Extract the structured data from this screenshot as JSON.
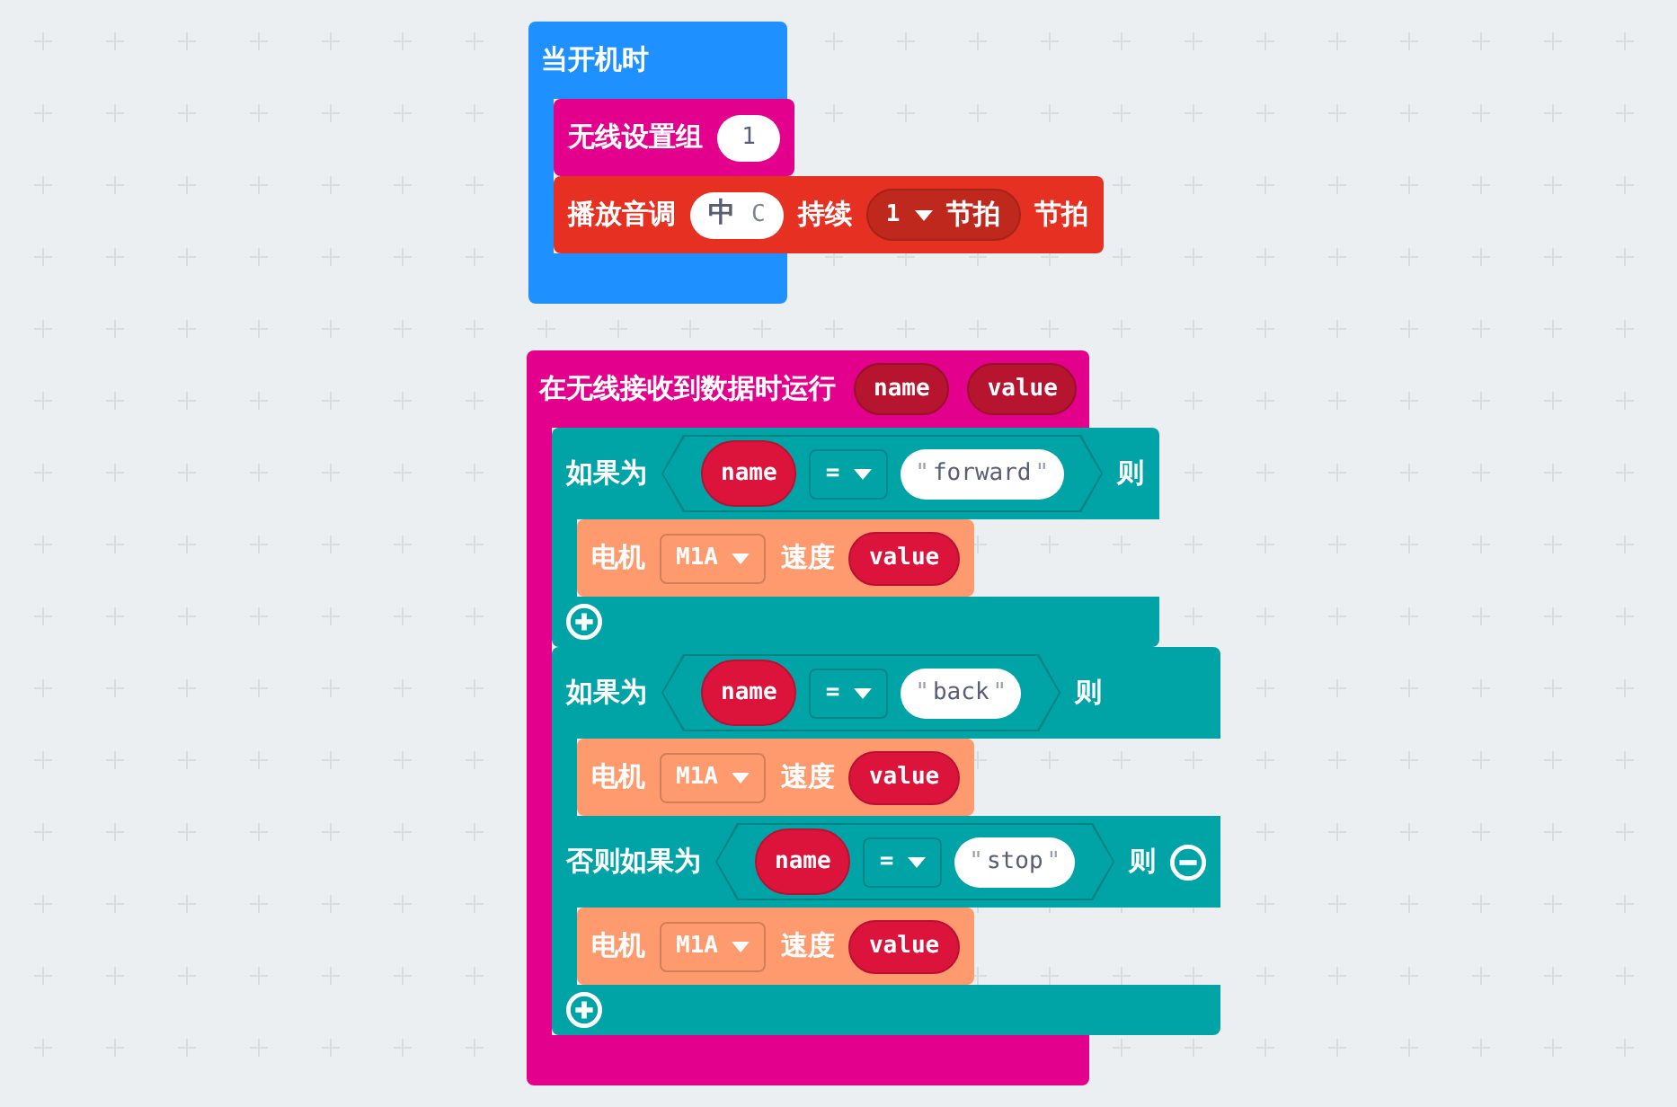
{
  "workspace": {
    "stacks": [
      {
        "kind": "event",
        "color": "#1e90ff",
        "header": [
          {
            "kind": "label",
            "text": "当开机时"
          }
        ],
        "body": [
          {
            "kind": "statement",
            "color": "#e3008c",
            "parts": [
              {
                "kind": "label",
                "text": "无线设置组"
              },
              {
                "kind": "number",
                "text": "1"
              }
            ]
          },
          {
            "kind": "statement",
            "color": "#e63022",
            "parts": [
              {
                "kind": "label",
                "text": "播放音调"
              },
              {
                "kind": "note",
                "octave": "中",
                "pitch": "C"
              },
              {
                "kind": "label",
                "text": "持续"
              },
              {
                "kind": "dropdown_oval",
                "value": "1",
                "unit": "节拍"
              },
              {
                "kind": "label",
                "text": "节拍"
              }
            ]
          }
        ]
      },
      {
        "kind": "event",
        "color": "#e3008c",
        "header": [
          {
            "kind": "label",
            "text": "在无线接收到数据时运行"
          },
          {
            "kind": "param",
            "text": "name"
          },
          {
            "kind": "param",
            "text": "value"
          }
        ],
        "body": [
          {
            "kind": "if",
            "color": "#00a4a6",
            "clauses": [
              {
                "removable": false,
                "header": [
                  {
                    "kind": "label",
                    "text": "如果为"
                  },
                  {
                    "kind": "condition",
                    "parts": [
                      {
                        "kind": "reporter",
                        "text": "name"
                      },
                      {
                        "kind": "dropdown",
                        "text": "="
                      },
                      {
                        "kind": "string",
                        "open_quote": "\"",
                        "text": "forward",
                        "close_quote": "\""
                      }
                    ]
                  },
                  {
                    "kind": "label",
                    "text": "则"
                  }
                ],
                "body": [
                  {
                    "kind": "statement",
                    "color": "#ff9a6e",
                    "parts": [
                      {
                        "kind": "label",
                        "text": "电机"
                      },
                      {
                        "kind": "dropdown",
                        "text": "M1A"
                      },
                      {
                        "kind": "label",
                        "text": "速度"
                      },
                      {
                        "kind": "reporter",
                        "text": "value"
                      }
                    ]
                  }
                ]
              }
            ]
          },
          {
            "kind": "if",
            "color": "#00a4a6",
            "clauses": [
              {
                "removable": false,
                "header": [
                  {
                    "kind": "label",
                    "text": "如果为"
                  },
                  {
                    "kind": "condition",
                    "parts": [
                      {
                        "kind": "reporter",
                        "text": "name"
                      },
                      {
                        "kind": "dropdown",
                        "text": "="
                      },
                      {
                        "kind": "string",
                        "open_quote": "\"",
                        "text": "back",
                        "close_quote": "\""
                      }
                    ]
                  },
                  {
                    "kind": "label",
                    "text": "则"
                  }
                ],
                "body": [
                  {
                    "kind": "statement",
                    "color": "#ff9a6e",
                    "parts": [
                      {
                        "kind": "label",
                        "text": "电机"
                      },
                      {
                        "kind": "dropdown",
                        "text": "M1A"
                      },
                      {
                        "kind": "label",
                        "text": "速度"
                      },
                      {
                        "kind": "reporter",
                        "text": "value"
                      }
                    ]
                  }
                ]
              },
              {
                "removable": true,
                "header": [
                  {
                    "kind": "label",
                    "text": "否则如果为"
                  },
                  {
                    "kind": "condition",
                    "parts": [
                      {
                        "kind": "reporter",
                        "text": "name"
                      },
                      {
                        "kind": "dropdown",
                        "text": "="
                      },
                      {
                        "kind": "string",
                        "open_quote": "\"",
                        "text": "stop",
                        "close_quote": "\""
                      }
                    ]
                  },
                  {
                    "kind": "label",
                    "text": "则"
                  }
                ],
                "body": [
                  {
                    "kind": "statement",
                    "color": "#ff9a6e",
                    "parts": [
                      {
                        "kind": "label",
                        "text": "电机"
                      },
                      {
                        "kind": "dropdown",
                        "text": "M1A"
                      },
                      {
                        "kind": "label",
                        "text": "速度"
                      },
                      {
                        "kind": "reporter",
                        "text": "value"
                      }
                    ]
                  }
                ]
              }
            ]
          }
        ]
      }
    ]
  }
}
